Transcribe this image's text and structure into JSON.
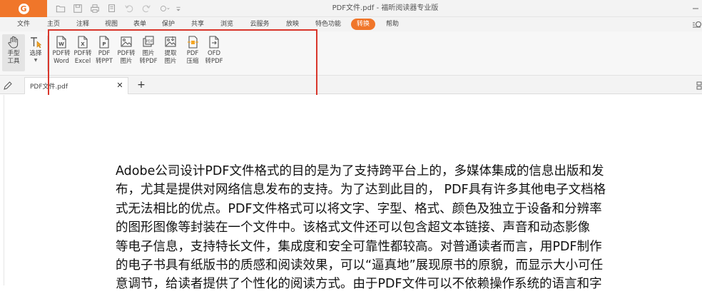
{
  "app": {
    "window_title": "PDF文件.pdf - 福昕阅读器专业版",
    "logo_glyph": "G",
    "accent_color": "#f0762a"
  },
  "quick_access": [
    {
      "name": "open-icon"
    },
    {
      "name": "save-icon"
    },
    {
      "name": "print-icon"
    },
    {
      "name": "copy-icon"
    },
    {
      "name": "undo-icon"
    },
    {
      "name": "redo-icon"
    },
    {
      "name": "stamp-icon"
    },
    {
      "name": "customize-icon"
    }
  ],
  "menu": {
    "items": [
      "文件",
      "主页",
      "注释",
      "视图",
      "表单",
      "保护",
      "共享",
      "浏览",
      "云服务",
      "放映",
      "特色功能",
      "转换",
      "帮助"
    ],
    "active_index": 11
  },
  "ribbon": {
    "tools": [
      {
        "id": "hand",
        "label1": "手型",
        "label2": "工具",
        "icon": "hand-icon"
      },
      {
        "id": "select",
        "label1": "选择",
        "label2": "",
        "icon": "text-select-icon"
      },
      {
        "id": "pdf2word",
        "label1": "PDF转",
        "label2": "Word",
        "icon": "pdf-to-word-icon"
      },
      {
        "id": "pdf2excel",
        "label1": "PDF转",
        "label2": "Excel",
        "icon": "pdf-to-excel-icon"
      },
      {
        "id": "pdf2ppt",
        "label1": "PDF",
        "label2": "转PPT",
        "icon": "pdf-to-ppt-icon"
      },
      {
        "id": "pdf2img",
        "label1": "PDF转",
        "label2": "图片",
        "icon": "pdf-to-image-icon"
      },
      {
        "id": "img2pdf",
        "label1": "图片",
        "label2": "转PDF",
        "icon": "image-to-pdf-icon"
      },
      {
        "id": "extractimg",
        "label1": "提取",
        "label2": "图片",
        "icon": "extract-image-icon"
      },
      {
        "id": "compress",
        "label1": "PDF",
        "label2": "压缩",
        "icon": "pdf-compress-icon"
      },
      {
        "id": "ofd2pdf",
        "label1": "OFD",
        "label2": "转PDF",
        "icon": "ofd-to-pdf-icon"
      }
    ]
  },
  "tabs": {
    "doc_tab_label": "PDF文件.pdf",
    "close_glyph": "✕",
    "add_glyph": "+"
  },
  "document": {
    "lines": [
      "Adobe公司设计PDF文件格式的目的是为了支持跨平台上的，多媒体集成的信息出版和发",
      "布，尤其是提供对网络信息发布的支持。为了达到此目的， PDF具有许多其他电子文档格",
      "式无法相比的优点。PDF文件格式可以将文字、字型、格式、颜色及独立于设备和分辨率",
      "的图形图像等封装在一个文件中。该格式文件还可以包含超文本链接、声音和动态影像",
      "等电子信息，支持特长文件，集成度和安全可靠性都较高。对普通读者而言，用PDF制作",
      "的电子书具有纸版书的质感和阅读效果，可以“逼真地”展现原书的原貌，而显示大小可任",
      "意调节，给读者提供了个性化的阅读方式。由于PDF文件可以不依赖操作系统的语言和字"
    ]
  }
}
